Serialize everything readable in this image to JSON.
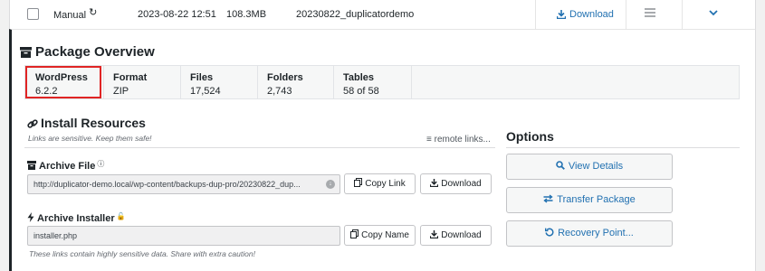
{
  "package_row": {
    "type": "Manual",
    "date": "2023-08-22 12:51",
    "size": "108.3MB",
    "name": "20230822_duplicatordemo",
    "download_label": "Download"
  },
  "overview": {
    "title": "Package Overview",
    "stats": [
      {
        "label": "WordPress",
        "value": "6.2.2"
      },
      {
        "label": "Format",
        "value": "ZIP"
      },
      {
        "label": "Files",
        "value": "17,524"
      },
      {
        "label": "Folders",
        "value": "2,743"
      },
      {
        "label": "Tables",
        "value": "58 of 58"
      }
    ]
  },
  "install": {
    "title": "Install Resources",
    "subtitle": "Links are sensitive. Keep them safe!",
    "remote_links": "remote links...",
    "archive": {
      "title": "Archive File",
      "url": "http://duplicator-demo.local/wp-content/backups-dup-pro/20230822_dup...",
      "copy_label": "Copy Link",
      "download_label": "Download"
    },
    "installer": {
      "title": "Archive Installer",
      "value": "installer.php",
      "copy_label": "Copy Name",
      "download_label": "Download"
    },
    "note": "These links contain highly sensitive data. Share with extra caution!"
  },
  "options": {
    "title": "Options",
    "buttons": [
      {
        "label": "View Details",
        "icon": "search-icon"
      },
      {
        "label": "Transfer Package",
        "icon": "transfer-icon"
      },
      {
        "label": "Recovery Point...",
        "icon": "undo-icon"
      }
    ]
  },
  "colors": {
    "accent": "#2271b1",
    "highlight": "#e02424"
  }
}
